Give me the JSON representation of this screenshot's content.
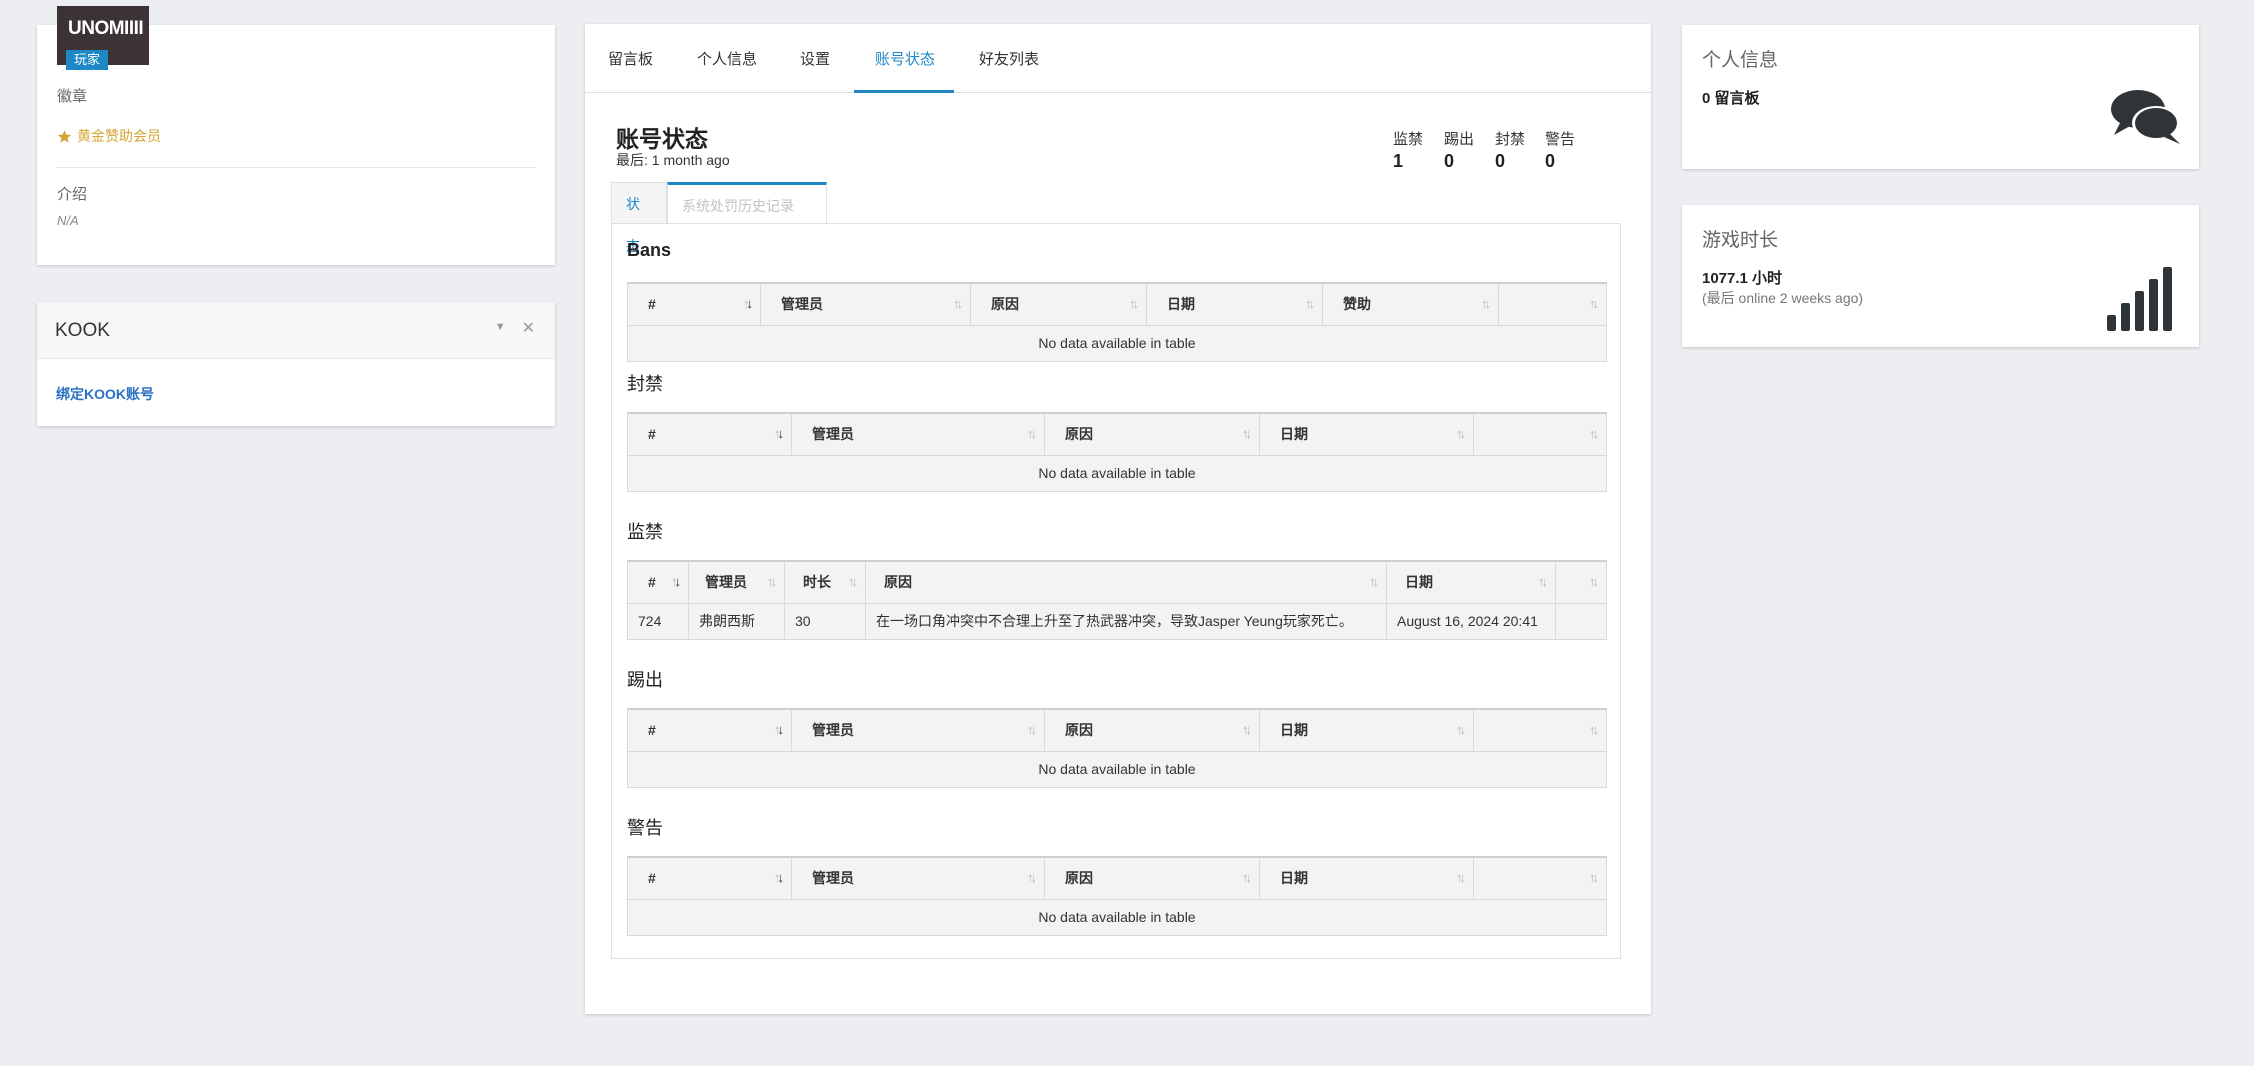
{
  "profile": {
    "username": "UNOMIIII",
    "role": "玩家",
    "badges_label": "徽章",
    "badge": "黄金赞助会员",
    "intro_label": "介绍",
    "intro_value": "N/A"
  },
  "kook": {
    "title": "KOOK",
    "bind_link": "绑定KOOK账号"
  },
  "nav": {
    "tabs": [
      "留言板",
      "个人信息",
      "设置",
      "账号状态",
      "好友列表"
    ],
    "active": "账号状态"
  },
  "account": {
    "title": "账号状态",
    "last": "最后: 1 month ago",
    "stats": [
      {
        "label": "监禁",
        "value": "1"
      },
      {
        "label": "踢出",
        "value": "0"
      },
      {
        "label": "封禁",
        "value": "0"
      },
      {
        "label": "警告",
        "value": "0"
      }
    ],
    "subtabs": [
      "状态",
      "系统处罚历史记录"
    ]
  },
  "sections": {
    "bans": {
      "title": "Bans",
      "columns": [
        "#",
        "管理员",
        "原因",
        "日期",
        "赞助",
        ""
      ],
      "empty": "No data available in table"
    },
    "blocks": {
      "title": "封禁",
      "columns": [
        "#",
        "管理员",
        "原因",
        "日期",
        ""
      ],
      "empty": "No data available in table"
    },
    "jails": {
      "title": "监禁",
      "columns": [
        "#",
        "管理员",
        "时长",
        "原因",
        "日期",
        ""
      ],
      "rows": [
        [
          "724",
          "弗朗西斯",
          "30",
          "在一场口角冲突中不合理上升至了热武器冲突，导致Jasper Yeung玩家死亡。",
          "August 16, 2024 20:41",
          ""
        ]
      ]
    },
    "kicks": {
      "title": "踢出",
      "columns": [
        "#",
        "管理员",
        "原因",
        "日期",
        ""
      ],
      "empty": "No data available in table"
    },
    "warnings": {
      "title": "警告",
      "columns": [
        "#",
        "管理员",
        "原因",
        "日期",
        ""
      ],
      "empty": "No data available in table"
    }
  },
  "right": {
    "info_title": "个人信息",
    "info_value": "0 留言板",
    "time_title": "游戏时长",
    "time_value": "1077.1 小时",
    "time_sub": "(最后 online 2 weeks ago)"
  },
  "icons": {
    "star": "star-icon",
    "chat": "chat-icon",
    "signal": "signal-bars-icon",
    "collapse": "caret-down-icon",
    "close": "close-icon",
    "sort": "sort-icon"
  },
  "colors": {
    "accent": "#1e88c7",
    "badge_gold": "#d4a633",
    "link": "#2b70c5"
  }
}
